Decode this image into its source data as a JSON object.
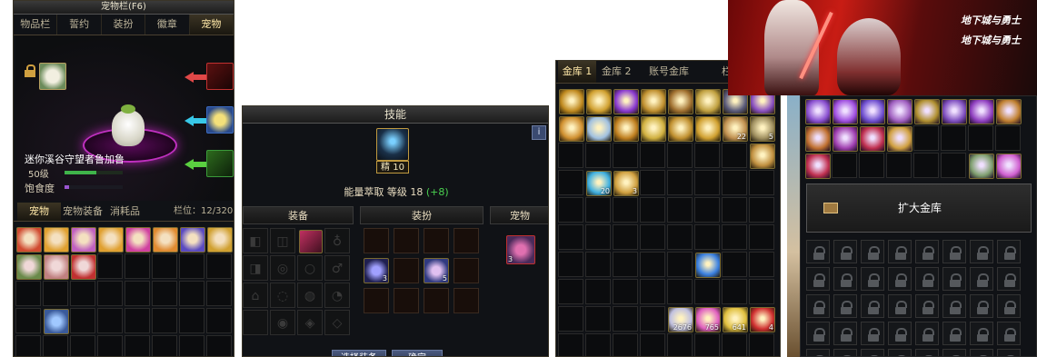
{
  "pet_window": {
    "title": "宠物栏(F6)",
    "tabs": [
      "物品栏",
      "誓约",
      "装扮",
      "徽章",
      "宠物"
    ],
    "active_tab": "宠物",
    "info_button": "i",
    "pet_name": "迷你溪谷守望者鲁加鲁",
    "pet_level": "50级",
    "satiety_label": "饱食度",
    "level_bar_fraction": 0.55,
    "satiety_bar_fraction": 0.08,
    "sub_tabs": [
      "宠物",
      "宠物装备",
      "消耗品"
    ],
    "active_sub_tab": "宠物",
    "slots_label": "栏位：12/320",
    "colors": {
      "accent": "#ffe8a8",
      "level_bar": "#3fb34a",
      "satiety_bar": "#9a55d0",
      "circle": "#c030c0"
    }
  },
  "skill_window": {
    "title": "技能",
    "info_button": "i",
    "skill_badge": "精 10",
    "skill_line_name": "能量萃取",
    "skill_line_level": "等级 18",
    "skill_line_bonus": "(+8)",
    "section_equip": "装备",
    "section_costume": "装扮",
    "section_pet": "宠物",
    "costume_counts": [
      "3",
      "5"
    ],
    "pet_count": "3",
    "bottom_buttons": [
      "选择装备",
      "确定"
    ]
  },
  "gold_vault": {
    "tabs": [
      "金库 1",
      "金库 2",
      "账号金库",
      "栏"
    ],
    "active_tab": "金库 1",
    "counts": [
      "22",
      "5",
      "20",
      "3",
      "2676",
      "765",
      "641",
      "4"
    ]
  },
  "banner": {
    "logo_text_1": "地下城与勇士",
    "logo_text_2": "地下城与勇士"
  },
  "account_vault": {
    "expand_button": "扩大金库"
  }
}
